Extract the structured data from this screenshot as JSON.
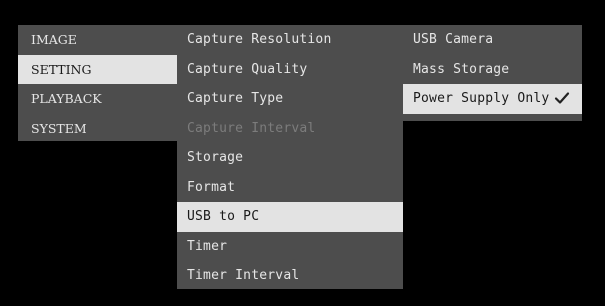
{
  "menu": {
    "categories": [
      {
        "label": "IMAGE",
        "selected": false
      },
      {
        "label": "SETTING",
        "selected": true
      },
      {
        "label": "PLAYBACK",
        "selected": false
      },
      {
        "label": "SYSTEM",
        "selected": false
      }
    ],
    "settings": [
      {
        "label": "Capture Resolution",
        "state": "normal"
      },
      {
        "label": "Capture Quality",
        "state": "normal"
      },
      {
        "label": "Capture Type",
        "state": "normal"
      },
      {
        "label": "Capture Interval",
        "state": "disabled"
      },
      {
        "label": "Storage",
        "state": "normal"
      },
      {
        "label": "Format",
        "state": "normal"
      },
      {
        "label": "USB to PC",
        "state": "selected"
      },
      {
        "label": "Timer",
        "state": "normal"
      },
      {
        "label": "Timer Interval",
        "state": "normal"
      }
    ],
    "usb_options": [
      {
        "label": "USB Camera",
        "state": "normal"
      },
      {
        "label": "Mass Storage",
        "state": "normal"
      },
      {
        "label": "Power Supply Only",
        "state": "selected",
        "checked": true
      }
    ],
    "colors": {
      "background": "#000000",
      "panel": "#4d4d4d",
      "highlight": "#e3e3e3",
      "text": "#e6e6e6",
      "disabled_text": "#7c7c7c"
    },
    "icons": {
      "checked_marker": "checkmark-icon"
    }
  }
}
